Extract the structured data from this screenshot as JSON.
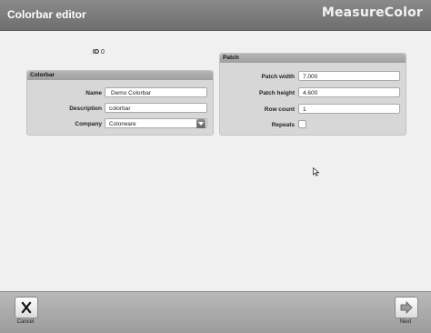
{
  "header": {
    "title": "Colorbar editor",
    "brand": "MeasureColor"
  },
  "id_row": {
    "label": "ID",
    "value": "0"
  },
  "colorbar": {
    "title": "Colorbar",
    "name": {
      "label": "Name",
      "value": "Demo Colorbar"
    },
    "description": {
      "label": "Description",
      "value": "colorbar"
    },
    "company": {
      "label": "Company",
      "value": "Colorware"
    }
  },
  "patch": {
    "title": "Patch",
    "patch_width": {
      "label": "Patch width",
      "value": "7.000"
    },
    "patch_height": {
      "label": "Patch height",
      "value": "4.600"
    },
    "row_count": {
      "label": "Row count",
      "value": "1"
    },
    "repeats": {
      "label": "Repeats",
      "checked": false
    }
  },
  "footer": {
    "cancel": {
      "label": "Cancel",
      "icon": "close-icon"
    },
    "next": {
      "label": "Next",
      "icon": "arrow-right-icon"
    }
  }
}
